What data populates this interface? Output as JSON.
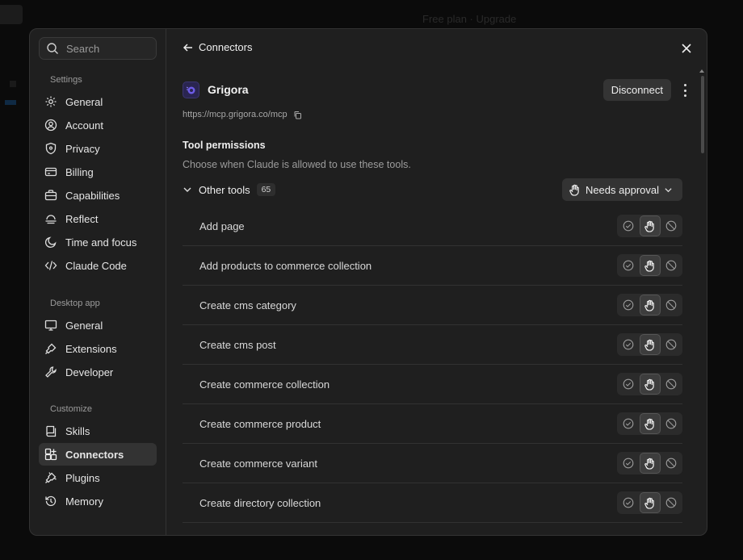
{
  "background": {
    "top_text": "Free plan · Upgrade"
  },
  "sidebar": {
    "search_placeholder": "Search",
    "sections": [
      {
        "title": "Settings",
        "items": [
          "General",
          "Account",
          "Privacy",
          "Billing",
          "Capabilities",
          "Reflect",
          "Time and focus",
          "Claude Code"
        ]
      },
      {
        "title": "Desktop app",
        "items": [
          "General",
          "Extensions",
          "Developer"
        ]
      },
      {
        "title": "Customize",
        "items": [
          "Skills",
          "Connectors",
          "Plugins",
          "Memory"
        ]
      }
    ],
    "active_item": "Connectors"
  },
  "header": {
    "back_label": "Connectors"
  },
  "connector": {
    "name": "Grigora",
    "url": "https://mcp.grigora.co/mcp",
    "disconnect_label": "Disconnect"
  },
  "permissions": {
    "title": "Tool permissions",
    "description": "Choose when Claude is allowed to use these tools.",
    "group_label": "Other tools",
    "group_count": "65",
    "approval_label": "Needs approval",
    "tools": [
      "Add page",
      "Add products to commerce collection",
      "Create cms category",
      "Create cms post",
      "Create commerce collection",
      "Create commerce product",
      "Create commerce variant",
      "Create directory collection"
    ]
  },
  "colors": {
    "accent_logo": "#6d5ce7",
    "modal_bg": "#1f1f1f",
    "active_nav": "#333333"
  }
}
